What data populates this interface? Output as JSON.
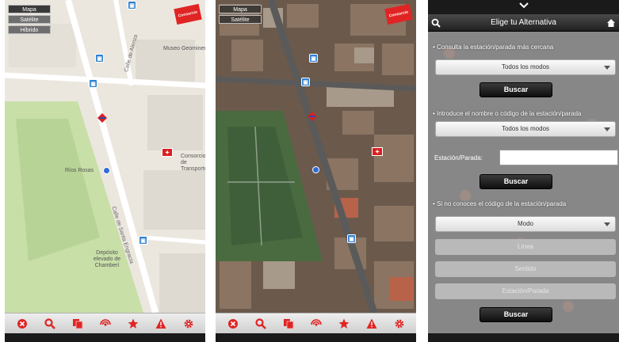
{
  "map_screen": {
    "map_type_buttons": [
      "Mapa",
      "Satélite",
      "Híbrido"
    ],
    "places": [
      "Museo Geominero",
      "Ríos Rosas",
      "Consorcio de Transportes",
      "Depósito elevado de Chamberí"
    ],
    "streets": [
      "Calle de Alenza",
      "Calle de Santa Engracia"
    ],
    "logo_text": "Consorcio"
  },
  "satellite_screen": {
    "map_type_buttons": [
      "Mapa",
      "Satélite"
    ],
    "logo_text": "Consorcio"
  },
  "toolbar": {
    "icons": [
      "close-circle-icon",
      "search-icon",
      "copy-icon",
      "signal-icon",
      "star-icon",
      "warning-icon",
      "gear-icon"
    ],
    "color": "#e02424"
  },
  "search_panel": {
    "title": "Elige tu Alternativa",
    "section1_label": "Consulta la estación/parada más cercana",
    "section1_dropdown": "Todos los modos",
    "section1_button": "Buscar",
    "section2_label": "Introduce el nombre o código de la estación/parada",
    "section2_dropdown": "Todos los modos",
    "station_label": "Estación/Parada:",
    "station_value": "",
    "section2_button": "Buscar",
    "section3_label": "Si no conoces el código de la estación/parada",
    "mode_dropdown": "Modo",
    "disabled_dropdowns": [
      "Línea",
      "Sentido",
      "Estación/Parada"
    ],
    "section3_button": "Buscar"
  },
  "colors": {
    "accent": "#e02424",
    "bus": "#2f7fd1",
    "park": "#c8dfa8",
    "panel_dark": "#202020"
  }
}
